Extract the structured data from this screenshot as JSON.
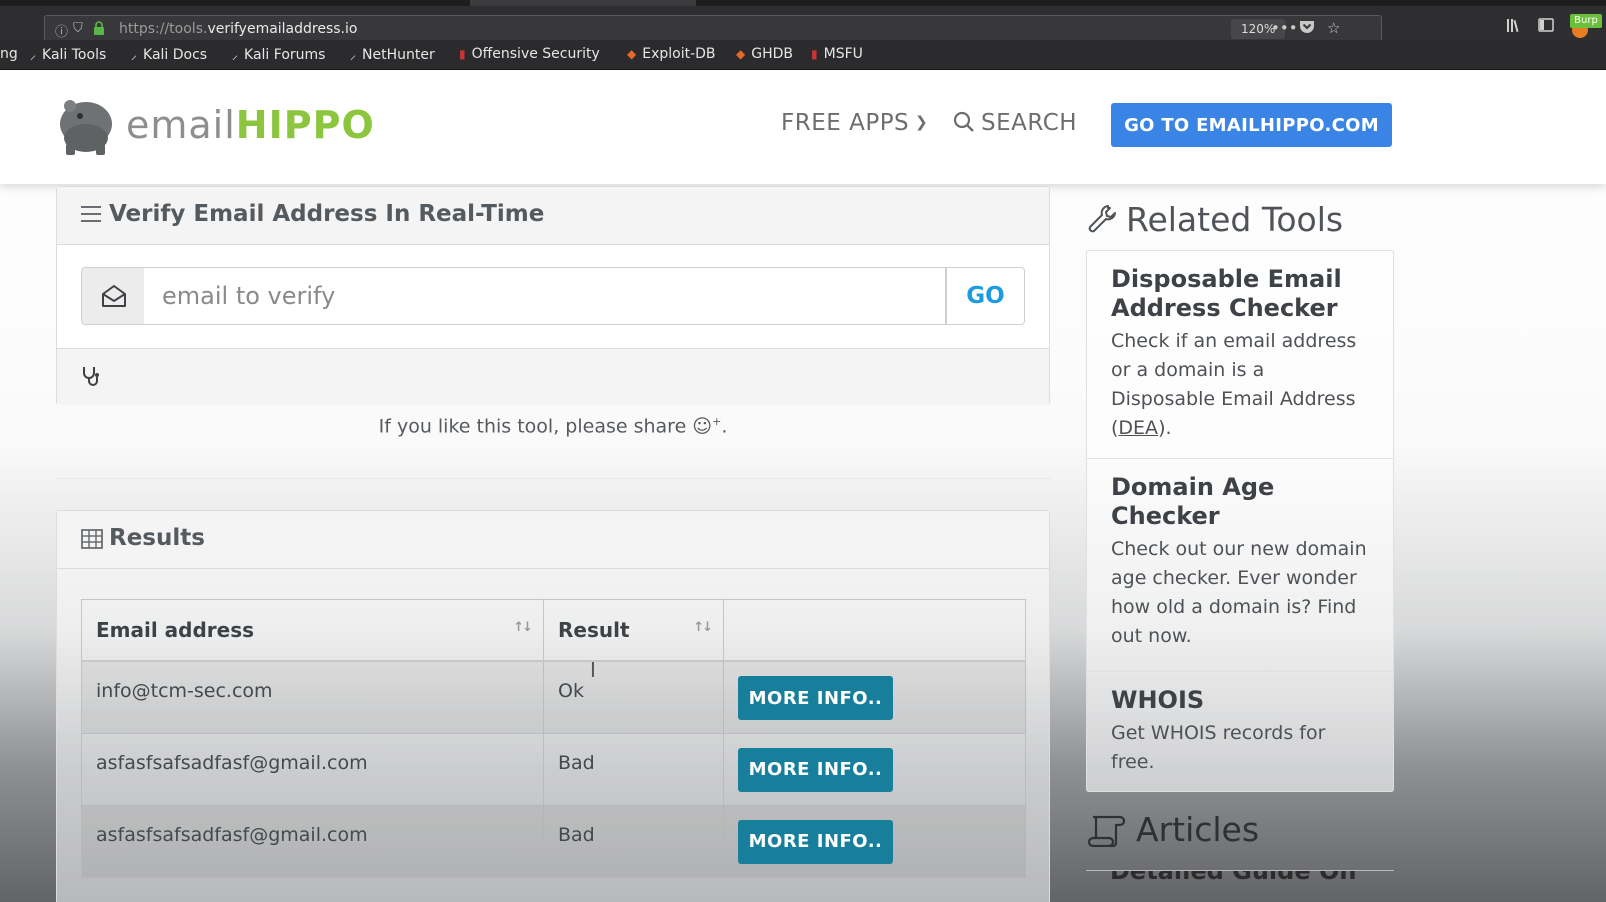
{
  "browser": {
    "url_prefix": "https://tools.",
    "url_domain": "verifyemailaddress.io",
    "zoom": "120%",
    "burp_label": "Burp",
    "bookmarks": [
      {
        "label": "ng"
      },
      {
        "label": "Kali Tools",
        "icon": "kali-icon"
      },
      {
        "label": "Kali Docs",
        "icon": "kali-icon"
      },
      {
        "label": "Kali Forums",
        "icon": "kali-icon"
      },
      {
        "label": "NetHunter",
        "icon": "kali-icon"
      },
      {
        "label": "Offensive Security",
        "icon": "offsec-icon"
      },
      {
        "label": "Exploit-DB",
        "icon": "exploitdb-icon"
      },
      {
        "label": "GHDB",
        "icon": "ghdb-icon"
      },
      {
        "label": "MSFU",
        "icon": "msfu-icon"
      }
    ]
  },
  "header": {
    "logo_light": "email",
    "logo_bold": "HIPPO",
    "nav_free_apps": "FREE APPS",
    "nav_search": "SEARCH",
    "cta": "GO TO EMAILHIPPO.COM"
  },
  "verify": {
    "title": "Verify Email Address In Real-Time",
    "placeholder": "email to verify",
    "go": "GO",
    "share_text": "If you like this tool, please share ☺",
    "share_sup": "+",
    "share_end": "."
  },
  "results": {
    "title": "Results",
    "columns": [
      "Email address",
      "Result",
      ""
    ],
    "rows": [
      {
        "email": "info@tcm-sec.com",
        "result": "Ok",
        "action": "MORE INFO.."
      },
      {
        "email": "asfasfsafsadfasf@gmail.com",
        "result": "Bad",
        "action": "MORE INFO.."
      },
      {
        "email": "asfasfsafsadfasf@gmail.com",
        "result": "Bad",
        "action": "MORE INFO.."
      }
    ]
  },
  "sidebar": {
    "related_heading": "Related Tools",
    "tools": [
      {
        "title": "Disposable Email Address Checker",
        "desc": "Check if an email address or a domain is a Disposable Email Address (",
        "abbr": "DEA",
        "desc_end": ")."
      },
      {
        "title": "Domain Age Checker",
        "desc": "Check out our new domain age checker. Ever wonder how old a domain is? Find out now."
      },
      {
        "title": "WHOIS",
        "desc": "Get WHOIS records for free."
      }
    ],
    "articles_heading": "Articles",
    "article_peek": "Detailed Guide On"
  },
  "colors": {
    "brand_green": "#8cc63f",
    "cta_blue": "#3a84e6",
    "go_blue": "#1d9be0",
    "more_info_teal": "#177f9b"
  }
}
